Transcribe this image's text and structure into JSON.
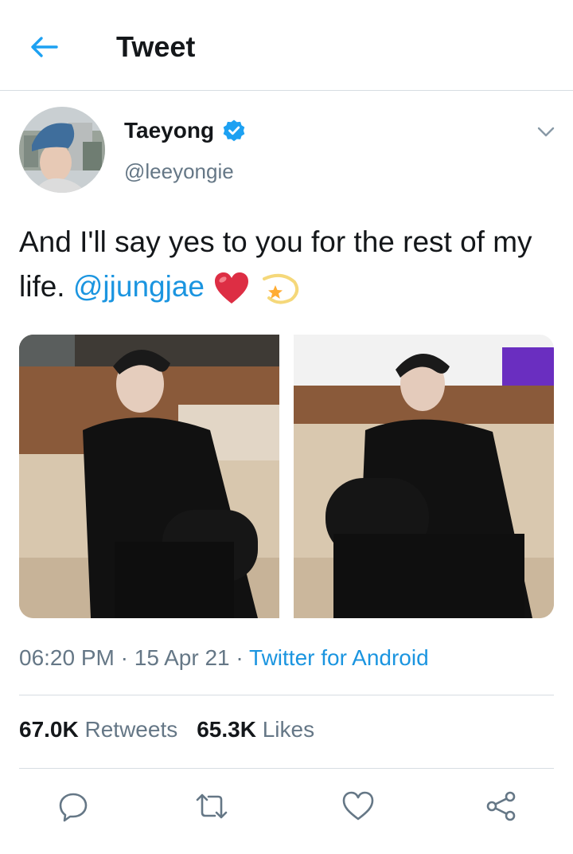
{
  "header": {
    "title": "Tweet"
  },
  "author": {
    "display_name": "Taeyong",
    "handle": "@leeyongie",
    "verified": true
  },
  "tweet": {
    "text_before": "And I'll say yes to you for the rest of my life. ",
    "mention": "@jjungjae",
    "emojis": [
      "heart-emoji",
      "dizzy-star-emoji"
    ]
  },
  "meta": {
    "time": "06:20 PM",
    "separator": " · ",
    "date": "15 Apr 21",
    "source": "Twitter for Android"
  },
  "stats": {
    "retweets_count": "67.0K",
    "retweets_label": "Retweets",
    "likes_count": "65.3K",
    "likes_label": "Likes"
  },
  "actions": [
    "reply-icon",
    "retweet-icon",
    "like-icon",
    "share-icon"
  ],
  "colors": {
    "accent": "#1b95e0",
    "text": "#14171a",
    "muted": "#657786",
    "border": "#d6dde2",
    "verified": "#1da1f2"
  }
}
